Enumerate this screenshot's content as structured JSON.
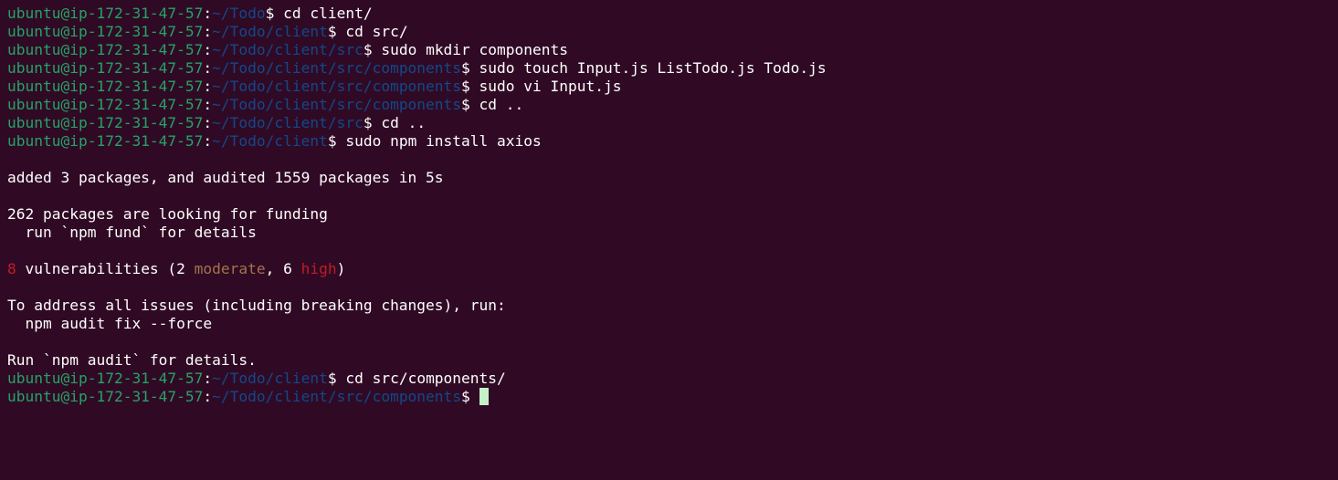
{
  "prompt": {
    "user_host": "ubuntu@ip-172-31-47-57",
    "colon": ":",
    "dollar": "$"
  },
  "session": [
    {
      "type": "cmd",
      "path": "~/Todo",
      "command": " cd client/"
    },
    {
      "type": "cmd",
      "path": "~/Todo/client",
      "command": " cd src/"
    },
    {
      "type": "cmd",
      "path": "~/Todo/client/src",
      "command": " sudo mkdir components"
    },
    {
      "type": "cmd",
      "path": "~/Todo/client/src/components",
      "command": " sudo touch Input.js ListTodo.js Todo.js"
    },
    {
      "type": "cmd",
      "path": "~/Todo/client/src/components",
      "command": " sudo vi Input.js"
    },
    {
      "type": "cmd",
      "path": "~/Todo/client/src/components",
      "command": " cd .."
    },
    {
      "type": "cmd",
      "path": "~/Todo/client/src",
      "command": " cd .."
    },
    {
      "type": "cmd",
      "path": "~/Todo/client",
      "command": " sudo npm install axios"
    },
    {
      "type": "blank"
    },
    {
      "type": "out",
      "text": "added 3 packages, and audited 1559 packages in 5s"
    },
    {
      "type": "blank"
    },
    {
      "type": "out",
      "text": "262 packages are looking for funding"
    },
    {
      "type": "out",
      "text": "  run `npm fund` for details"
    },
    {
      "type": "blank"
    },
    {
      "type": "vuln",
      "count": "8",
      "t1": " vulnerabilities (2 ",
      "moderate": "moderate",
      "t2": ", 6 ",
      "high": "high",
      "t3": ")"
    },
    {
      "type": "blank"
    },
    {
      "type": "out",
      "text": "To address all issues (including breaking changes), run:"
    },
    {
      "type": "out",
      "text": "  npm audit fix --force"
    },
    {
      "type": "blank"
    },
    {
      "type": "out",
      "text": "Run `npm audit` for details."
    },
    {
      "type": "cmd",
      "path": "~/Todo/client",
      "command": " cd src/components/"
    },
    {
      "type": "cmd",
      "path": "~/Todo/client/src/components",
      "command": " ",
      "cursor": true
    }
  ],
  "colors": {
    "background": "#300a24",
    "user": "#26a269",
    "path": "#12488b",
    "red": "#c01c28",
    "moderate": "#a2734c",
    "cursor": "#c4f0c8"
  }
}
